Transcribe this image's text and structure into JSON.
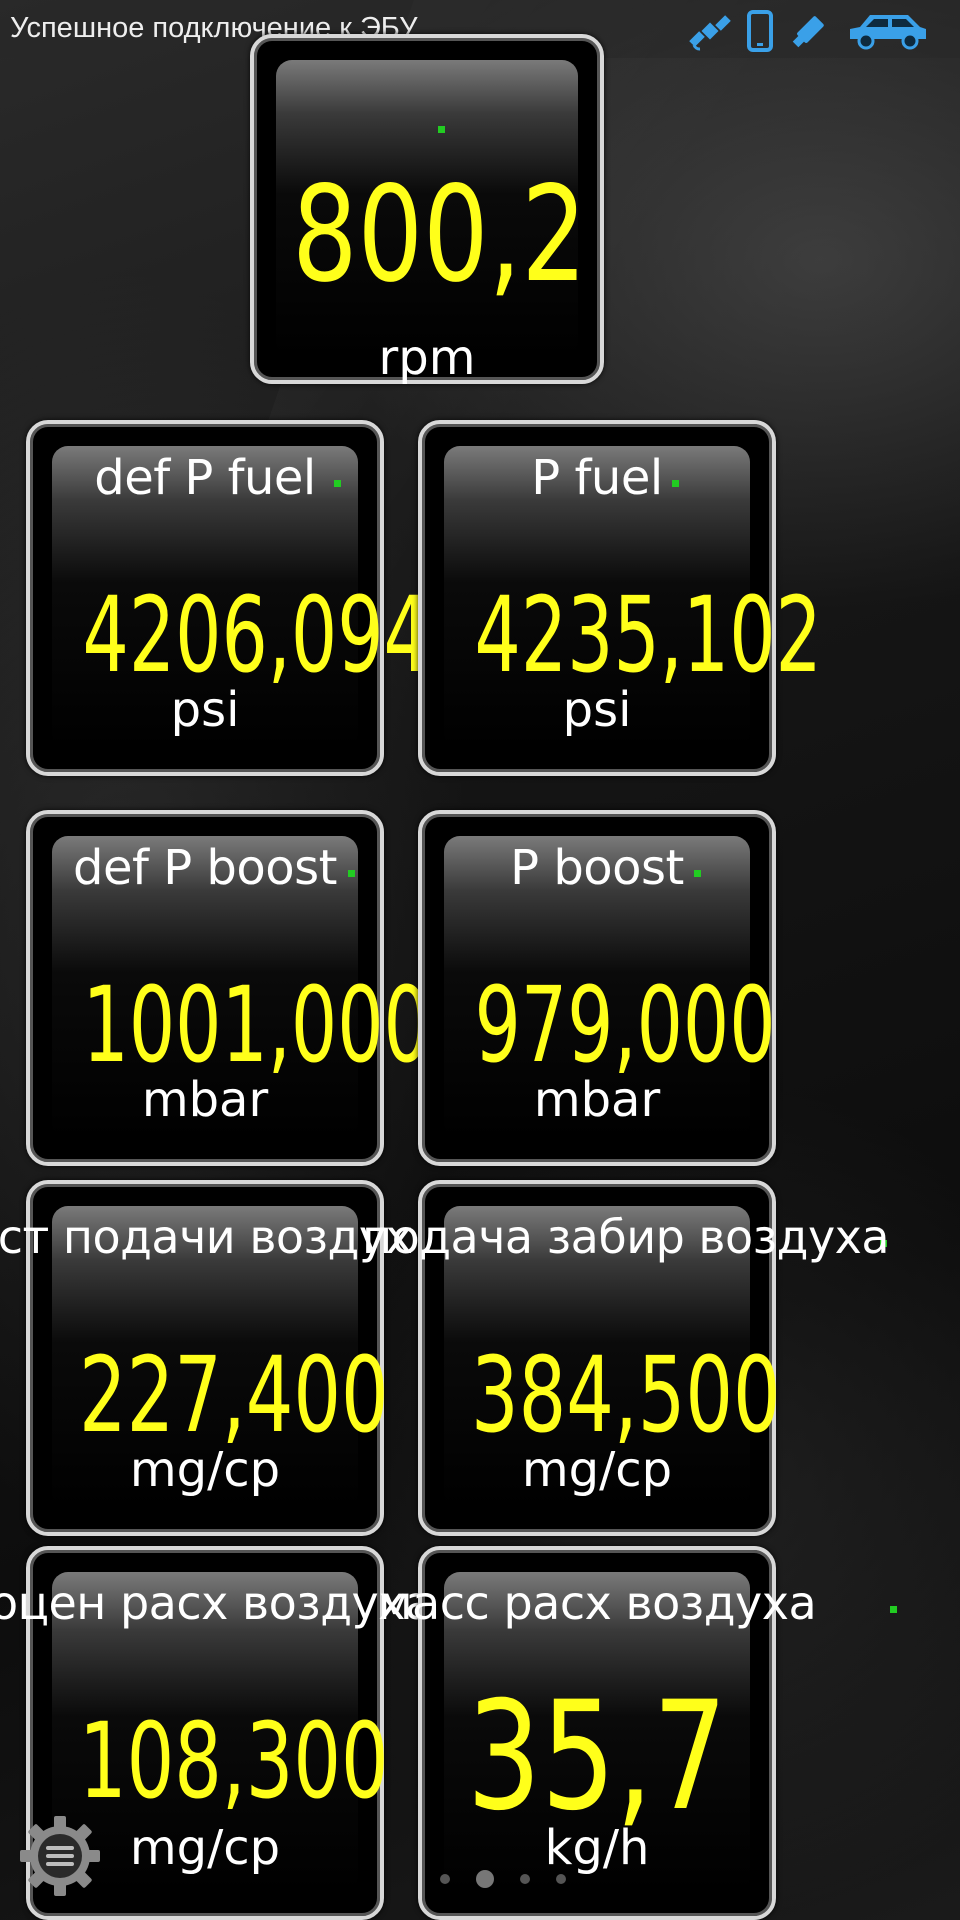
{
  "status_bar": {
    "message": "Успешное подключение к ЭБУ",
    "icons": [
      "satellite-icon",
      "phone-icon",
      "usb-stick-icon",
      "car-icon"
    ],
    "icon_color": "#3aa0e8"
  },
  "colors": {
    "value": "#ffff1a",
    "label": "#ffffff",
    "indicator": "#22cc22"
  },
  "gauges": {
    "rpm": {
      "label": "",
      "value": "800,2",
      "unit": "rpm"
    },
    "def_p_fuel": {
      "label": "def P fuel",
      "value": "4206,094",
      "unit": "psi"
    },
    "p_fuel": {
      "label": "P fuel",
      "value": "4235,102",
      "unit": "psi"
    },
    "def_p_boost": {
      "label": "def P boost",
      "value": "1001,000",
      "unit": "mbar"
    },
    "p_boost": {
      "label": "P boost",
      "value": "979,000",
      "unit": "mbar"
    },
    "air_1": {
      "label": "ст подачи воздух",
      "value": "227,400",
      "unit": "mg/cp"
    },
    "air_2": {
      "label": "подача забир воздуха",
      "value": "384,500",
      "unit": "mg/cp"
    },
    "air_3": {
      "label": "оцен расх воздуха",
      "value": "108,300",
      "unit": "mg/cp"
    },
    "air_4": {
      "label": "масс расх воздуха",
      "value": "35,7",
      "unit": "kg/h"
    }
  },
  "pager": {
    "pages": 4,
    "active_index": 1
  }
}
